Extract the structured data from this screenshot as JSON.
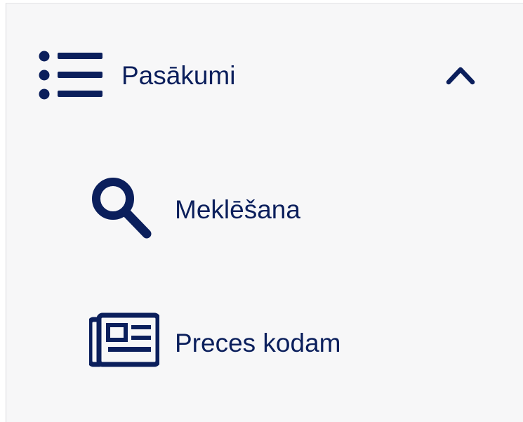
{
  "menu": {
    "section_title": "Pasākumi",
    "section_icon": "list-icon",
    "toggle_icon": "chevron-up-icon",
    "expanded": true,
    "items": [
      {
        "label": "Meklēšana",
        "icon": "search-icon"
      },
      {
        "label": "Preces kodam",
        "icon": "newspaper-icon"
      }
    ]
  },
  "colors": {
    "text": "#0b1f5c",
    "background": "#f7f7f8"
  }
}
